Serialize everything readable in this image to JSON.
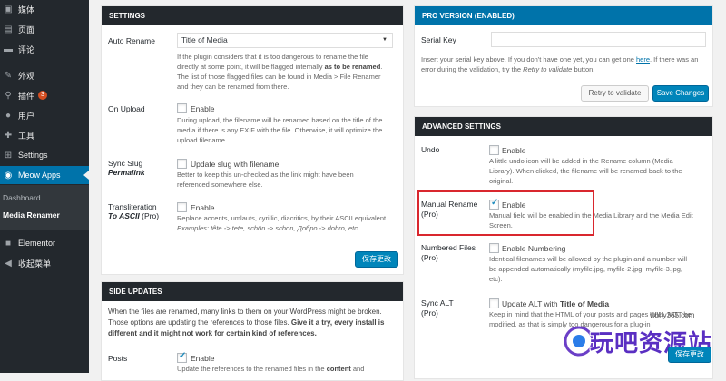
{
  "sidebar": {
    "items": [
      {
        "icon": "media-icon",
        "glyph": "▣",
        "label": "媒体"
      },
      {
        "icon": "pages-icon",
        "glyph": "▤",
        "label": "页面"
      },
      {
        "icon": "comments-icon",
        "glyph": "▬",
        "label": "评论"
      },
      {
        "icon": "appearance-icon",
        "glyph": "✎",
        "label": "外观"
      },
      {
        "icon": "plugins-icon",
        "glyph": "⚲",
        "label": "插件",
        "badge": "3"
      },
      {
        "icon": "users-icon",
        "glyph": "●",
        "label": "用户"
      },
      {
        "icon": "tools-icon",
        "glyph": "✚",
        "label": "工具"
      },
      {
        "icon": "settings-icon",
        "glyph": "⊞",
        "label": "Settings"
      },
      {
        "icon": "meow-apps-icon",
        "glyph": "◉",
        "label": "Meow Apps"
      }
    ],
    "submenu": [
      "Dashboard",
      "Media Renamer"
    ],
    "bottom": [
      {
        "icon": "elementor-icon",
        "glyph": "■",
        "label": "Elementor"
      },
      {
        "icon": "collapse-icon",
        "glyph": "◀",
        "label": "收起菜单"
      }
    ]
  },
  "settings": {
    "title": "SETTINGS",
    "auto_rename_label": "Auto Rename",
    "auto_rename_value": "Title of Media",
    "auto_rename_desc_1": "If the plugin considers that it is too dangerous to rename the file",
    "auto_rename_desc_2a": "directly at some point, it will be flagged internally ",
    "auto_rename_desc_2b": "as to be renamed",
    "auto_rename_desc_3": "The list of those flagged files can be found in Media > File Renamer",
    "auto_rename_desc_4": "and they can be renamed from there.",
    "on_upload_label": "On Upload",
    "on_upload_cb": "Enable",
    "on_upload_desc_1": "During upload, the filename will be renamed based on the title of the",
    "on_upload_desc_2": "media if there is any EXIF with the file. Otherwise, it will optimize the",
    "on_upload_desc_3": "upload filename.",
    "sync_slug_label": "Sync Slug",
    "sync_slug_sub": "Permalink",
    "sync_slug_cb": "Update slug with filename",
    "sync_slug_desc_1": "Better to keep this un-checked as the link might have been",
    "sync_slug_desc_2": "referenced somewhere else.",
    "translit_label": "Transliteration",
    "translit_sub": "To ASCII",
    "translit_pro": " (Pro)",
    "translit_cb": "Enable",
    "translit_desc_1": "Replace accents, umlauts, cyrillic, diacritics, by their ASCII equivalent.",
    "translit_desc_2": "Examples: tête -> tete, schön -> schon, Добро -> dobro, etc.",
    "save_btn": "保存更改"
  },
  "side_updates": {
    "title": "SIDE UPDATES",
    "intro_1": "When the files are renamed, many links to them on your WordPress might be broken.",
    "intro_2a": "Those options are updating the references to those files. ",
    "intro_2b": "Give it a try, every install is",
    "intro_3": "different and it might not work for certain kind of references.",
    "posts_label": "Posts",
    "posts_cb": "Enable",
    "posts_desc_a": "Update the references to the renamed files in the ",
    "posts_desc_b": "content",
    "posts_desc_c": " and"
  },
  "pro": {
    "title": "PRO VERSION (ENABLED)",
    "serial_label": "Serial Key",
    "desc_1a": "Insert your serial key above. If you don't have one yet, you can get one ",
    "desc_1b": "here",
    "desc_1c": ". If there was an",
    "desc_2a": "error during the validation, try the ",
    "desc_2b": "Retry to validate",
    "desc_2c": " button.",
    "retry_btn": "Retry to validate",
    "save_btn": "Save Changes"
  },
  "advanced": {
    "title": "ADVANCED SETTINGS",
    "undo_label": "Undo",
    "undo_cb": "Enable",
    "undo_desc_1": "A little undo icon will be added in the Rename column (Media",
    "undo_desc_2": "Library). When clicked, the filename will be renamed back to the",
    "undo_desc_3": "original.",
    "manual_label": "Manual Rename",
    "manual_pro": "(Pro)",
    "manual_cb": "Enable",
    "manual_desc_1": "Manual field will be enabled in the Media Library and the Media Edit",
    "manual_desc_2": "Screen.",
    "numbered_label": "Numbered Files",
    "numbered_pro": "(Pro)",
    "numbered_cb": "Enable Numbering",
    "numbered_desc_1": "Identical filenames will be allowed by the plugin and a number will",
    "numbered_desc_2": "be appended automatically (myfile.jpg, myfile-2.jpg, myfile-3.jpg,",
    "numbered_desc_3": "etc).",
    "sync_alt_label": "Sync ALT",
    "sync_alt_pro": "(Pro)",
    "sync_alt_cb_a": "Update ALT with ",
    "sync_alt_cb_b": "Title of Media",
    "sync_alt_desc_1": "Keep in mind that the HTML of your posts and pages WILL NOT be",
    "sync_alt_desc_2": "modified, as that is simply too dangerous for a plug-in",
    "save_btn": "保存更改"
  },
  "watermark": {
    "url": "wbhy365.com",
    "text": "玩吧资源站"
  }
}
